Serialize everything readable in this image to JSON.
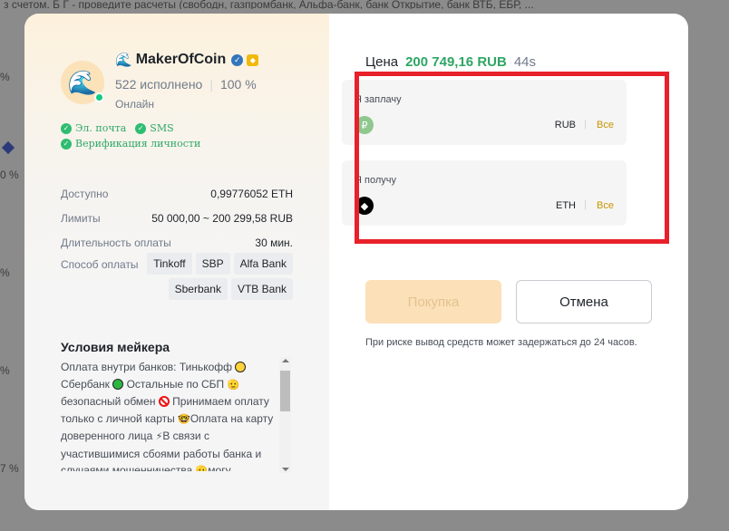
{
  "backdrop": {
    "top_text": "з счетом. Б Г - проведите расчеты (свободн, газпромбанк, Альфа-банк, банк Открытие, банк ВТБ, ЕБР, ..."
  },
  "maker": {
    "name": "MakerOfCoin",
    "orders": "522 исполнено",
    "completion": "100 %",
    "status": "Онлайн",
    "verifications": [
      "Эл. почта",
      "SMS",
      "Верификация личности"
    ]
  },
  "details": {
    "available_label": "Доступно",
    "available_value": "0,99776052 ETH",
    "limits_label": "Лимиты",
    "limits_value": "50 000,00 ~ 200 299,58 RUB",
    "duration_label": "Длительность оплаты",
    "duration_value": "30 мин.",
    "payment_label": "Способ оплаты",
    "payment_methods": [
      "Tinkoff",
      "SBP",
      "Alfa Bank",
      "Sberbank",
      "VTB Bank"
    ]
  },
  "terms": {
    "title": "Условия мейкера",
    "line1": "Оплата внутри банков: Тинькофф",
    "line2a": "Сбербанк",
    "line2b": "Остальные по СБП",
    "line3a": "безопасный обмен",
    "line3b": "Принимаем оплату",
    "line4a": "только с личной карты",
    "line4b": "Оплата на карту",
    "line5a": "доверенного лица",
    "line5b": "В связи с",
    "line6": "участившимися сбоями работы банка и",
    "line7a": "случаями мошенничества",
    "line7b": "могу"
  },
  "order": {
    "price_label": "Цена",
    "price_value": "200 749,16 RUB",
    "timer": "44s",
    "pay_label": "Я заплачу",
    "pay_currency": "RUB",
    "pay_all": "Все",
    "receive_label": "Я получу",
    "receive_currency": "ETH",
    "receive_all": "Все",
    "buy_button": "Покупка",
    "cancel_button": "Отмена",
    "risk_note": "При риске вывод средств может задержаться до 24 часов."
  },
  "colors": {
    "price_green": "#2ea564",
    "buy_disabled_bg": "#fbe0b8",
    "highlight_red": "#e8202a",
    "all_link": "#c99400"
  }
}
